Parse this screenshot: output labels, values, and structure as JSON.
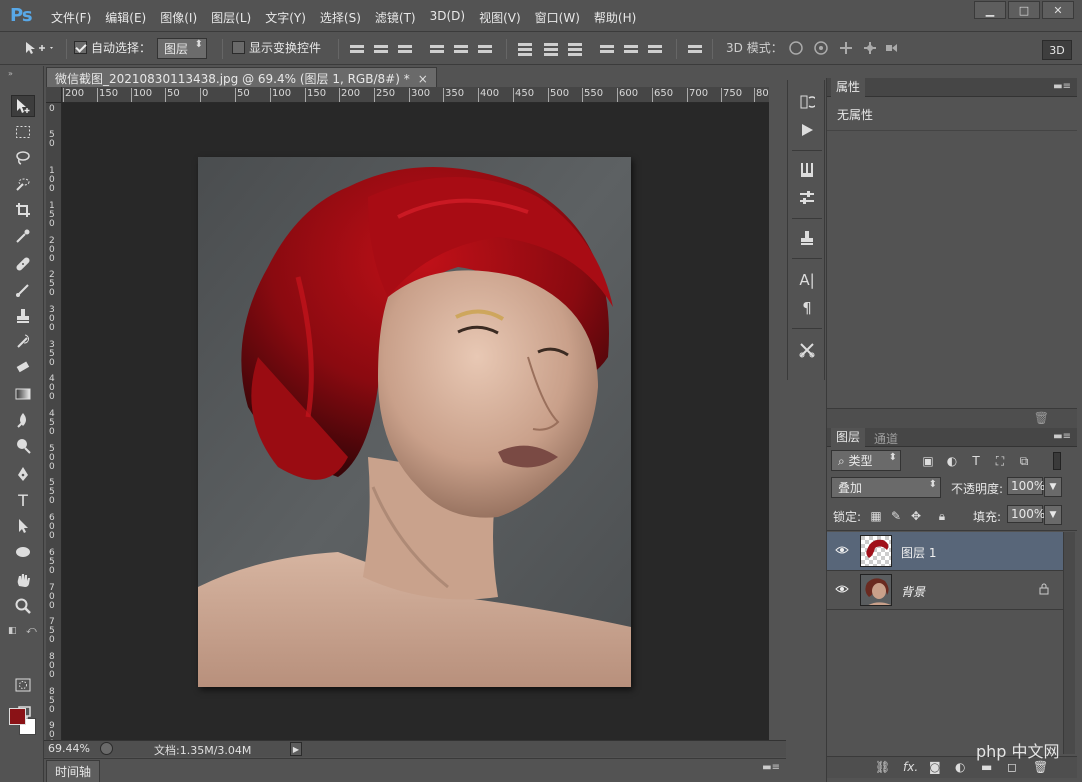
{
  "app": {
    "logo": "Ps",
    "menu": [
      "文件(F)",
      "编辑(E)",
      "图像(I)",
      "图层(L)",
      "文字(Y)",
      "选择(S)",
      "滤镜(T)",
      "3D(D)",
      "视图(V)",
      "窗口(W)",
      "帮助(H)"
    ],
    "window_controls": [
      "▁",
      "□",
      "✕"
    ]
  },
  "options_bar": {
    "auto_select_label": "自动选择：",
    "auto_select_checked": true,
    "auto_select_target": "图层",
    "show_transform_label": "显示变换控件",
    "show_transform_checked": false,
    "mode_3d_label": "3D 模式：",
    "btn_3d": "3D"
  },
  "document": {
    "tab_title": "微信截图_20210830113438.jpg @ 69.4% (图层 1, RGB/8#) *",
    "close": "×",
    "ruler_top": [
      "200",
      "150",
      "100",
      "50",
      "0",
      "50",
      "100",
      "150",
      "200",
      "250",
      "300",
      "350",
      "400",
      "450",
      "500",
      "550",
      "600",
      "650",
      "700",
      "750",
      "80"
    ],
    "ruler_left": [
      "0",
      "5 0",
      "1 0 0",
      "1 5 0",
      "2 0 0",
      "2 5 0",
      "3 0 0",
      "3 5 0",
      "4 0 0",
      "4 5 0",
      "5 0 0",
      "5 5 0",
      "6 0 0",
      "6 5 0",
      "7 0 0",
      "7 5 0",
      "8 0 0",
      "8 5 0",
      "9 0 0"
    ],
    "foreground_color": "#8a1216",
    "background_color": "#ffffff"
  },
  "status": {
    "zoom": "69.44%",
    "doc_info": "文档:1.35M/3.04M"
  },
  "timeline": {
    "label": "时间轴"
  },
  "properties_panel": {
    "tab": "属性",
    "empty_text": "无属性"
  },
  "layers_panel": {
    "tabs": [
      "图层",
      "通道"
    ],
    "filter_kind": "类型",
    "blend_mode": "叠加",
    "opacity_label": "不透明度:",
    "opacity_value": "100%",
    "lock_label": "锁定:",
    "fill_label": "填充:",
    "fill_value": "100%",
    "layers": [
      {
        "name": "图层 1",
        "selected": true,
        "locked": false
      },
      {
        "name": "背景",
        "selected": false,
        "locked": true
      }
    ]
  },
  "watermark": "php 中文网"
}
